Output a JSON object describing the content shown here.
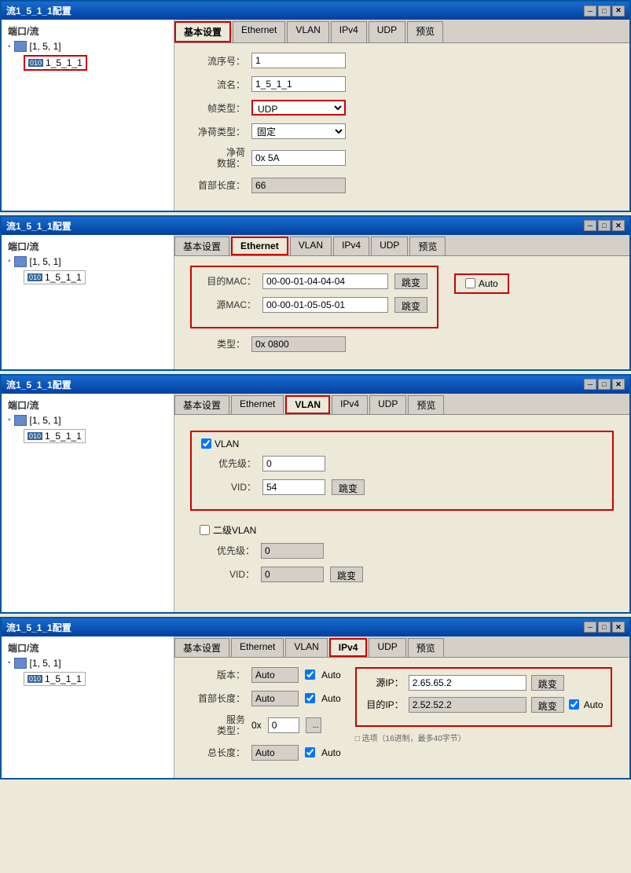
{
  "windows": [
    {
      "id": "window1",
      "title": "流1_5_1_1配置",
      "activeTab": "基本设置",
      "tabs": [
        "基本设置",
        "Ethernet",
        "VLAN",
        "IPv4",
        "UDP",
        "预览"
      ],
      "activeTabIndex": 0,
      "highlightedTabIndex": 0,
      "sidebar": {
        "header": "端口/流",
        "tree": "[1, 5, 1]",
        "leaf": "1_5_1_1",
        "leafId": "010"
      },
      "form": {
        "fields": [
          {
            "label": "流序号：",
            "value": "1",
            "type": "text"
          },
          {
            "label": "流名：",
            "value": "1_5_1_1",
            "type": "text"
          },
          {
            "label": "帧类型：",
            "value": "UDP",
            "type": "select",
            "highlighted": true
          },
          {
            "label": "净荷类型：",
            "value": "固定",
            "type": "select"
          },
          {
            "label": "净荷\n数据：",
            "value": "0x 5A",
            "type": "text"
          },
          {
            "label": "首部长度：",
            "value": "66",
            "type": "text",
            "readonly": true
          }
        ]
      }
    },
    {
      "id": "window2",
      "title": "流1_5_1_1配置",
      "activeTab": "Ethernet",
      "tabs": [
        "基本设置",
        "Ethernet",
        "VLAN",
        "IPv4",
        "UDP",
        "预览"
      ],
      "activeTabIndex": 1,
      "highlightedTabIndex": 1,
      "sidebar": {
        "header": "端口/流",
        "tree": "[1, 5, 1]",
        "leaf": "1_5_1_1",
        "leafId": "010"
      },
      "ethernet": {
        "destMacLabel": "目的MAC：",
        "destMac": "00-00-01-04-04-04",
        "srcMacLabel": "源MAC：",
        "srcMac": "00-00-01-05-05-01",
        "typeLabel": "类型：",
        "typeValue": "0x 0800",
        "jumpLabel": "跳变",
        "autoLabel": "Auto"
      }
    },
    {
      "id": "window3",
      "title": "流1_5_1_1配置",
      "activeTab": "VLAN",
      "tabs": [
        "基本设置",
        "Ethernet",
        "VLAN",
        "IPv4",
        "UDP",
        "预览"
      ],
      "activeTabIndex": 2,
      "highlightedTabIndex": 2,
      "sidebar": {
        "header": "端口/流",
        "tree": "[1, 5, 1]",
        "leaf": "1_5_1_1",
        "leafId": "010"
      },
      "vlan": {
        "vlanLabel": "VLAN",
        "priorityLabel": "优先级：",
        "priorityValue": "0",
        "vidLabel": "VID：",
        "vidValue": "54",
        "jumpLabel": "跳变",
        "secondVlanLabel": "二级VLAN",
        "secondPriorityLabel": "优先级：",
        "secondPriorityValue": "0",
        "secondVidLabel": "VID：",
        "secondVidValue": "0",
        "secondJumpLabel": "跳变"
      }
    },
    {
      "id": "window4",
      "title": "流1_5_1_1配置",
      "activeTab": "IPv4",
      "tabs": [
        "基本设置",
        "Ethernet",
        "VLAN",
        "IPv4",
        "UDP",
        "预览"
      ],
      "activeTabIndex": 3,
      "highlightedTabIndex": 3,
      "sidebar": {
        "header": "端口/流",
        "tree": "[1, 5, 1]",
        "leaf": "1_5_1_1",
        "leafId": "010"
      },
      "ipv4": {
        "versionLabel": "版本：",
        "versionValue": "Auto",
        "headerLenLabel": "首部长度：",
        "headerLenValue": "Auto",
        "serviceTypeLabel": "服务\n类型：",
        "serviceTypeValue": "0x 0",
        "totalLenLabel": "总长度：",
        "totalLenValue": "Auto",
        "srcIpLabel": "源IP：",
        "srcIpValue": "2.65.65.2",
        "destIpLabel": "目的IP：",
        "destIpValue": "2.52.52.2",
        "jumpLabel": "跳变",
        "autoLabel": "Auto",
        "bottomNote": "□ 选项（16进制，最多40字节）"
      }
    }
  ],
  "labels": {
    "minimize": "─",
    "maximize": "□",
    "close": "✕"
  }
}
